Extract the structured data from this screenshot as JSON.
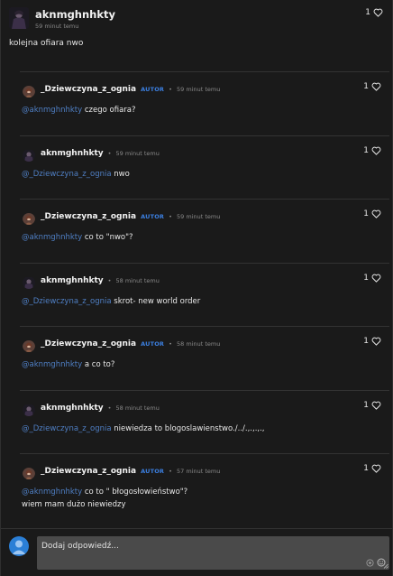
{
  "post": {
    "author": "aknmghnhkty",
    "time": "59 minut temu",
    "text": "kolejna ofiara nwo",
    "likes": "1"
  },
  "replies": [
    {
      "author": "_Dziewczyna_z_ognia",
      "badge": "AUTOR",
      "time": "59 minut temu",
      "mention": "@aknmghnhkty",
      "text": " czego ofiara?",
      "likes": "1",
      "avatar": "fire"
    },
    {
      "author": "aknmghnhkty",
      "badge": "",
      "time": "59 minut temu",
      "mention": "@_Dziewczyna_z_ognia",
      "text": " nwo",
      "likes": "1",
      "avatar": "dark"
    },
    {
      "author": "_Dziewczyna_z_ognia",
      "badge": "AUTOR",
      "time": "59 minut temu",
      "mention": "@aknmghnhkty",
      "text": " co to \"nwo\"?",
      "likes": "1",
      "avatar": "fire"
    },
    {
      "author": "aknmghnhkty",
      "badge": "",
      "time": "58 minut temu",
      "mention": "@_Dziewczyna_z_ognia",
      "text": " skrot- new world order",
      "likes": "1",
      "avatar": "dark"
    },
    {
      "author": "_Dziewczyna_z_ognia",
      "badge": "AUTOR",
      "time": "58 minut temu",
      "mention": "@aknmghnhkty",
      "text": " a co to?",
      "likes": "1",
      "avatar": "fire"
    },
    {
      "author": "aknmghnhkty",
      "badge": "",
      "time": "58 minut temu",
      "mention": "@_Dziewczyna_z_ognia",
      "text": " niewiedza to blogoslawienstwo./../.,.,.,.,",
      "likes": "1",
      "avatar": "dark"
    },
    {
      "author": "_Dziewczyna_z_ognia",
      "badge": "AUTOR",
      "time": "57 minut temu",
      "mention": "@aknmghnhkty",
      "text": " co to \" błogosłowieństwo\"?",
      "text2": "wiem mam dużo niewiedzy",
      "likes": "1",
      "avatar": "fire"
    }
  ],
  "compose": {
    "placeholder": "Dodaj odpowiedź..."
  }
}
